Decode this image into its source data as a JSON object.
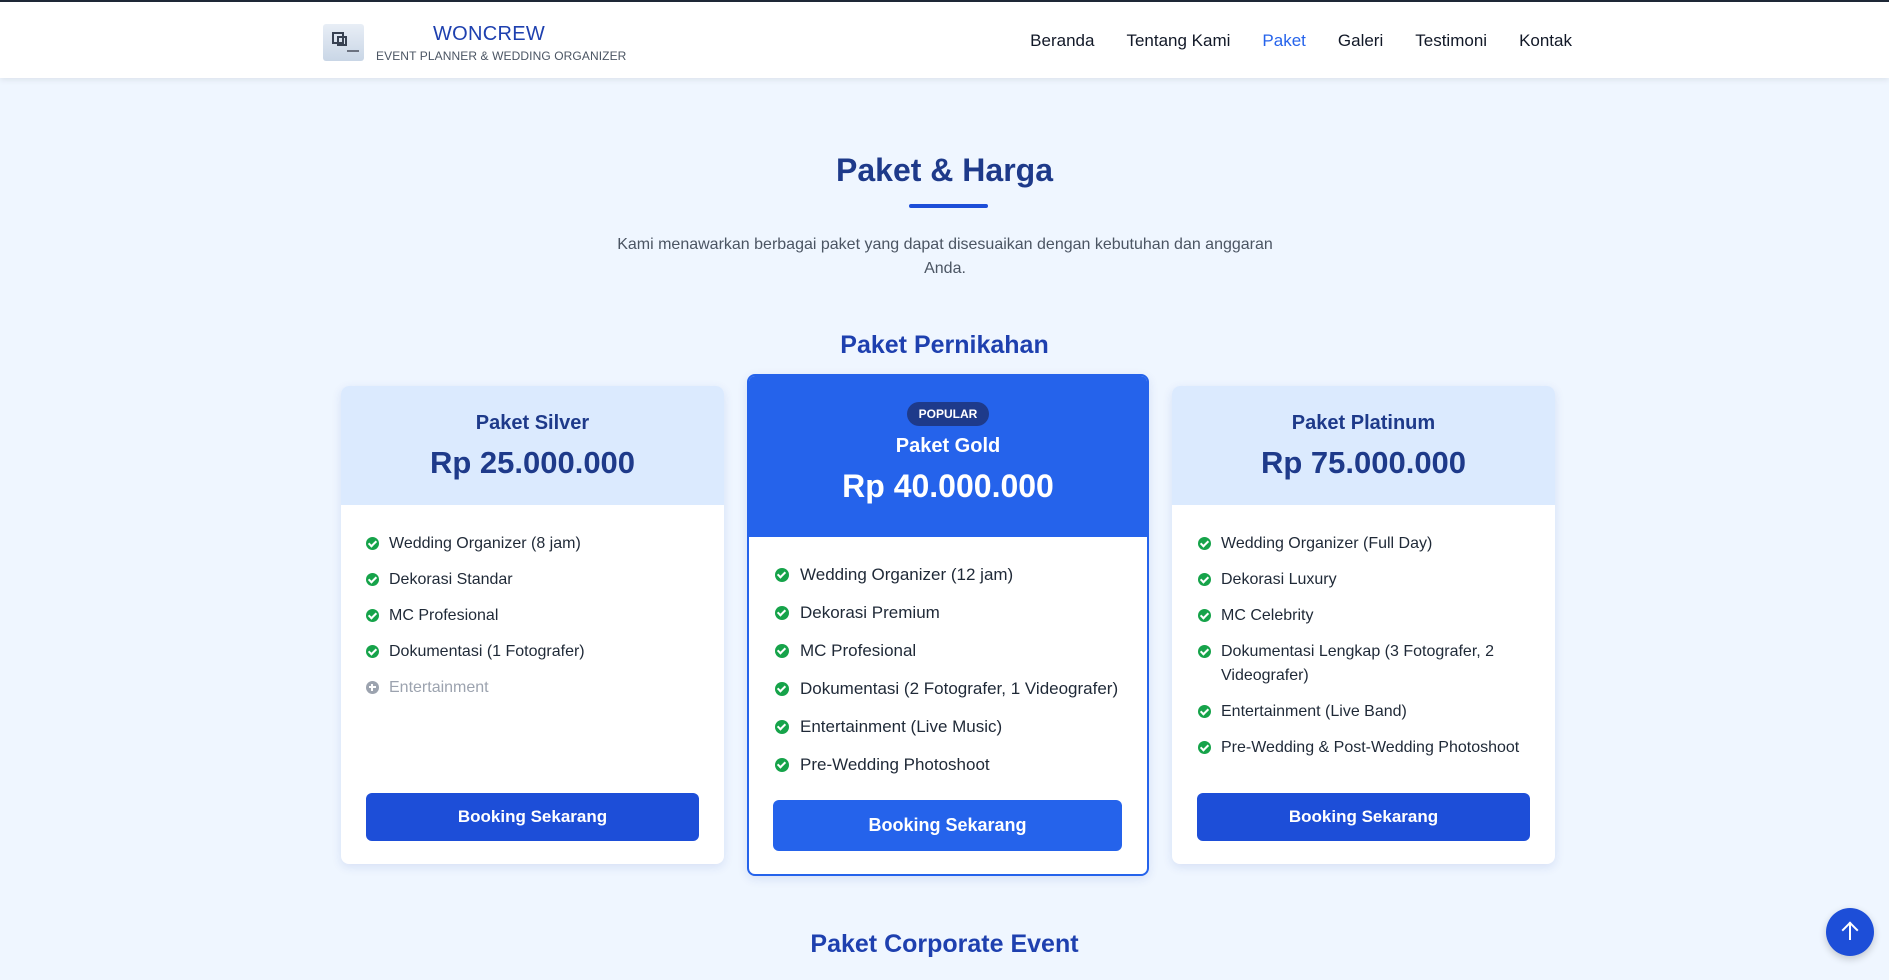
{
  "header": {
    "brand_name": "WONCREW",
    "brand_tagline": "EVENT PLANNER & WEDDING ORGANIZER",
    "nav": [
      {
        "label": "Beranda"
      },
      {
        "label": "Tentang Kami"
      },
      {
        "label": "Paket",
        "active": true
      },
      {
        "label": "Galeri"
      },
      {
        "label": "Testimoni"
      },
      {
        "label": "Kontak"
      }
    ]
  },
  "section": {
    "title": "Paket & Harga",
    "subtitle": "Kami menawarkan berbagai paket yang dapat disesuaikan dengan kebutuhan dan anggaran Anda."
  },
  "wedding": {
    "heading": "Paket Pernikahan",
    "silver": {
      "name": "Paket Silver",
      "price": "Rp 25.000.000",
      "features": [
        {
          "text": "Wedding Organizer (8 jam)",
          "included": true
        },
        {
          "text": "Dekorasi Standar",
          "included": true
        },
        {
          "text": "MC Profesional",
          "included": true
        },
        {
          "text": "Dokumentasi (1 Fotografer)",
          "included": true
        },
        {
          "text": "Entertainment",
          "included": false
        }
      ],
      "button": "Booking Sekarang"
    },
    "gold": {
      "badge": "POPULAR",
      "name": "Paket Gold",
      "price": "Rp 40.000.000",
      "features": [
        {
          "text": "Wedding Organizer (12 jam)",
          "included": true
        },
        {
          "text": "Dekorasi Premium",
          "included": true
        },
        {
          "text": "MC Profesional",
          "included": true
        },
        {
          "text": "Dokumentasi (2 Fotografer, 1 Videografer)",
          "included": true
        },
        {
          "text": "Entertainment (Live Music)",
          "included": true
        },
        {
          "text": "Pre-Wedding Photoshoot",
          "included": true
        }
      ],
      "button": "Booking Sekarang"
    },
    "platinum": {
      "name": "Paket Platinum",
      "price": "Rp 75.000.000",
      "features": [
        {
          "text": "Wedding Organizer (Full Day)",
          "included": true
        },
        {
          "text": "Dekorasi Luxury",
          "included": true
        },
        {
          "text": "MC Celebrity",
          "included": true
        },
        {
          "text": "Dokumentasi Lengkap (3 Fotografer, 2 Videografer)",
          "included": true
        },
        {
          "text": "Entertainment (Live Band)",
          "included": true
        },
        {
          "text": "Pre-Wedding & Post-Wedding Photoshoot",
          "included": true
        }
      ],
      "button": "Booking Sekarang"
    }
  },
  "corporate": {
    "heading": "Paket Corporate Event"
  },
  "colors": {
    "primary": "#1d4ed8",
    "accent": "#2563eb",
    "heading": "#1e3a8a",
    "check": "#16a34a",
    "background": "#eff6ff"
  },
  "icons": {
    "included": "check-circle-icon",
    "excluded": "plus-circle-icon",
    "scroll_top": "arrow-up-icon"
  }
}
